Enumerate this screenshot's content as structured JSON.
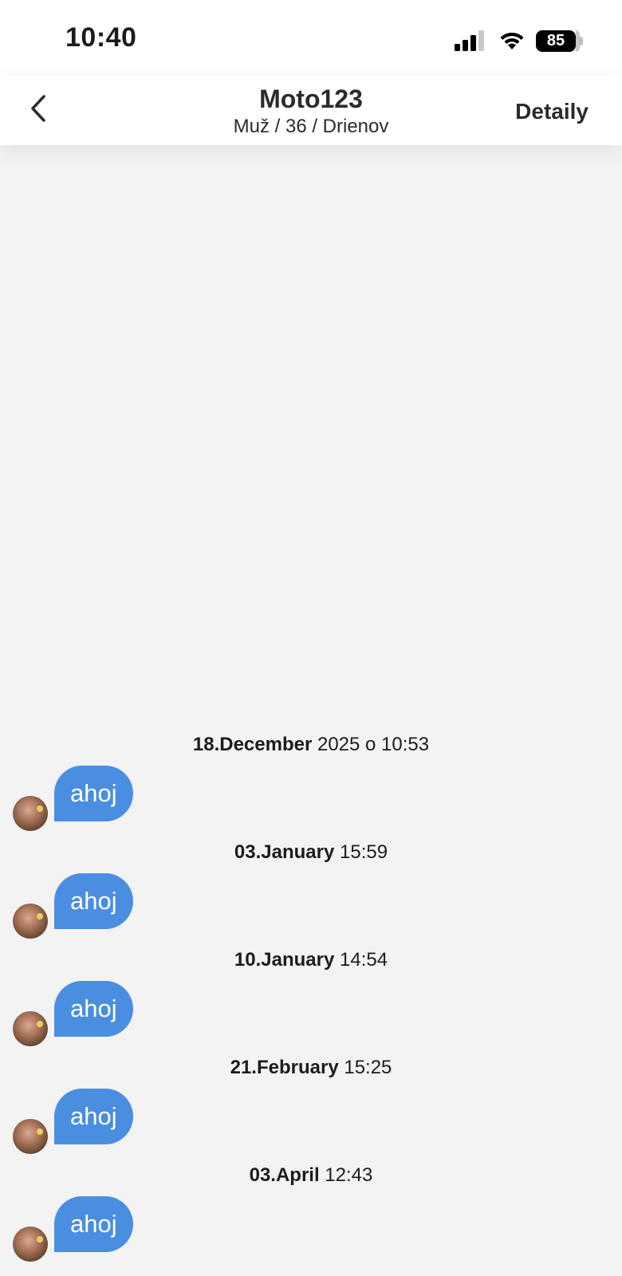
{
  "status_bar": {
    "time": "10:40",
    "battery": "85"
  },
  "header": {
    "title": "Moto123",
    "subtitle": "Muž / 36 / Drienov",
    "detail_label": "Detaily"
  },
  "messages": [
    {
      "date_bold": "18.December",
      "date_rest": " 2025 o 10:53",
      "text": "ahoj"
    },
    {
      "date_bold": "03.January",
      "date_rest": " 15:59",
      "text": "ahoj"
    },
    {
      "date_bold": "10.January",
      "date_rest": " 14:54",
      "text": "ahoj"
    },
    {
      "date_bold": "21.February",
      "date_rest": " 15:25",
      "text": "ahoj"
    },
    {
      "date_bold": "03.April",
      "date_rest": " 12:43",
      "text": "ahoj"
    }
  ],
  "colors": {
    "bubble": "#4a8ee2",
    "background": "#f3f3f4"
  },
  "icons": {
    "back": "chevron-left-icon",
    "signal": "cellular-signal-icon",
    "wifi": "wifi-icon",
    "battery": "battery-icon"
  }
}
